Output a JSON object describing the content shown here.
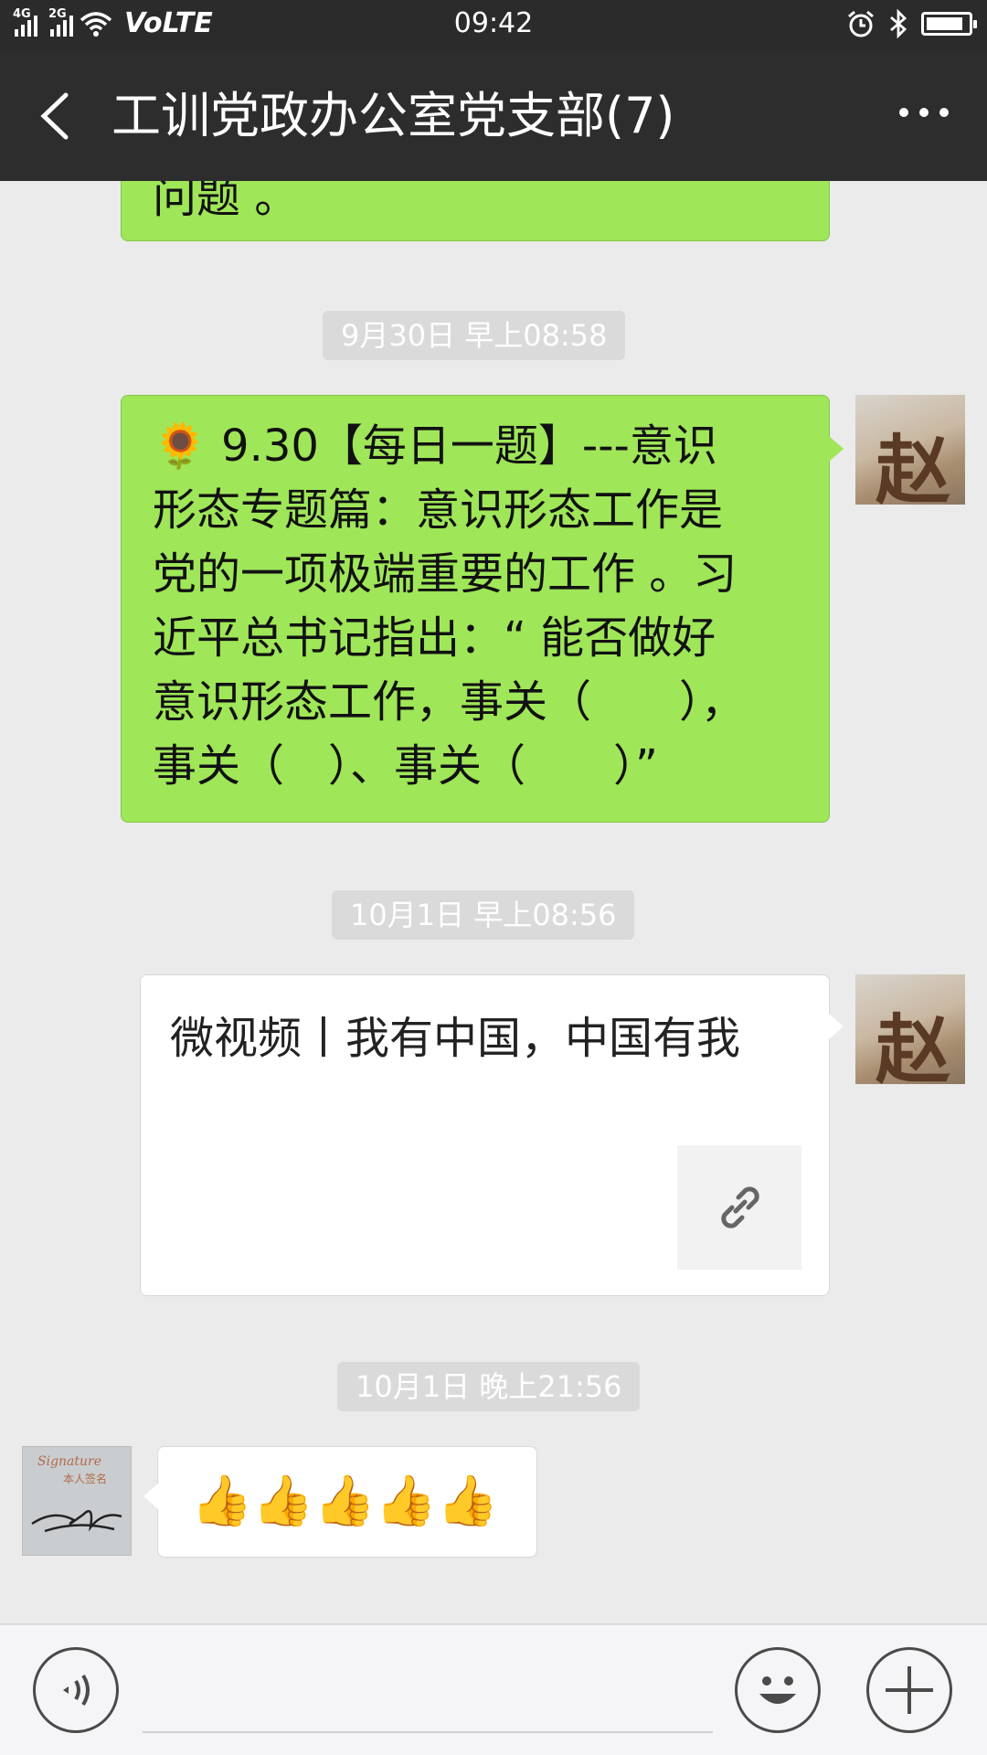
{
  "status_bar": {
    "network_1": "4G",
    "network_2": "2G",
    "volte": "VoLTE",
    "time": "09:42",
    "icons": [
      "signal-icon",
      "wifi-icon",
      "alarm-icon",
      "bluetooth-icon",
      "battery-icon"
    ],
    "battery_level": 0.8
  },
  "header": {
    "title": "工训党政办公室党支部(7)",
    "back_icon": "back-arrow-icon",
    "more_icon": "more-dots-icon"
  },
  "messages": {
    "partial_text": "问题 。",
    "ts1": "9月30日 早上08:58",
    "msg1_lines": [
      "🌻 9.30【每日一题】---意识",
      "形态专题篇：意识形态工作是",
      "党的一项极端重要的工作 。习",
      "近平总书记指出：“ 能否做好",
      "意识形态工作，事关（　　），",
      "事关（　）、事关（　　）”"
    ],
    "ts2": "10月1日 早上08:56",
    "card_title": "微视频丨我有中国，中国有我",
    "ts3": "10月1日 晚上21:56",
    "msg3": "👍👍👍👍👍"
  },
  "avatars": {
    "zhao_text": "赵",
    "sign_text_1": "Signature",
    "sign_text_2": "本人签名"
  },
  "colors": {
    "bubble_green": "#9fe659",
    "header_bg": "#2d2d2d",
    "chat_bg": "#ebebeb"
  },
  "input_bar": {
    "voice_icon": "voice-icon",
    "emoji_icon": "emoji-icon",
    "plus_icon": "plus-icon"
  }
}
